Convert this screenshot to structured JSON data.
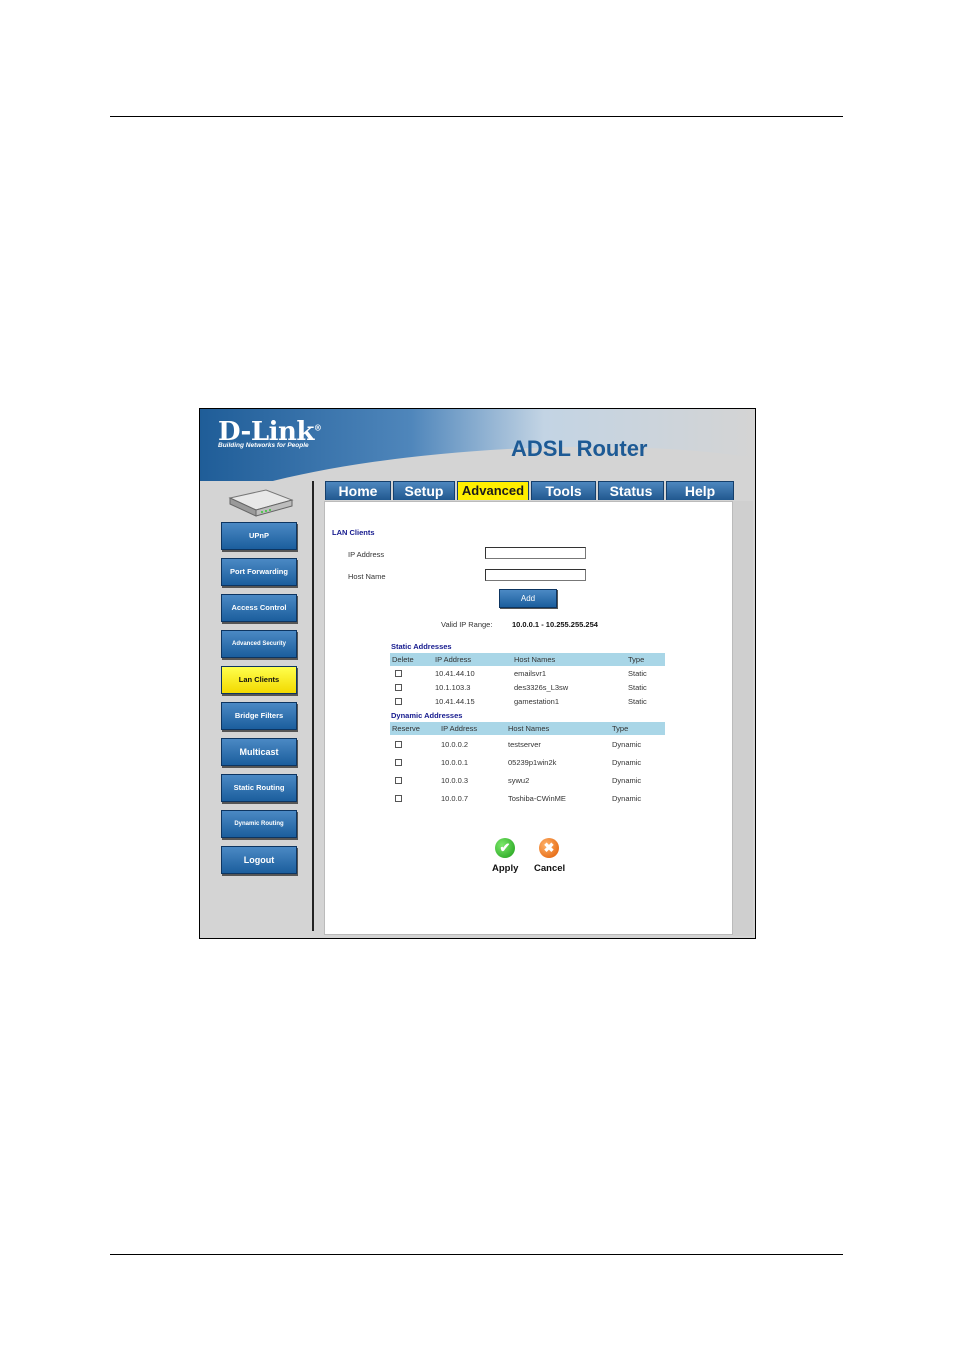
{
  "brand": {
    "logo_text": "D-Link",
    "logo_mark": "®",
    "tagline": "Building Networks for People",
    "product_title": "ADSL Router"
  },
  "tabs": [
    {
      "label": "Home"
    },
    {
      "label": "Setup"
    },
    {
      "label": "Advanced",
      "active": true
    },
    {
      "label": "Tools"
    },
    {
      "label": "Status"
    },
    {
      "label": "Help"
    }
  ],
  "sidebar": {
    "icon": "router-device-icon",
    "items": [
      {
        "label": "UPnP"
      },
      {
        "label": "Port Forwarding"
      },
      {
        "label": "Access Control"
      },
      {
        "label": "Advanced Security"
      },
      {
        "label": "Lan Clients",
        "active": true
      },
      {
        "label": "Bridge Filters"
      },
      {
        "label": "Multicast"
      },
      {
        "label": "Static Routing"
      },
      {
        "label": "Dynamic Routing"
      },
      {
        "label": "Logout"
      }
    ]
  },
  "lan_clients": {
    "title": "LAN Clients",
    "ip_address_label": "IP Address",
    "ip_address_value": "",
    "host_name_label": "Host Name",
    "host_name_value": "",
    "add_label": "Add",
    "valid_range_label": "Valid IP Range:",
    "valid_range_value": "10.0.0.1 - 10.255.255.254"
  },
  "static_addresses": {
    "title": "Static Addresses",
    "columns": [
      "Delete",
      "IP Address",
      "Host Names",
      "Type"
    ],
    "rows": [
      {
        "ip": "10.41.44.10",
        "host": "emailsvr1",
        "type": "Static"
      },
      {
        "ip": "10.1.103.3",
        "host": "des3326s_L3sw",
        "type": "Static"
      },
      {
        "ip": "10.41.44.15",
        "host": "gamestation1",
        "type": "Static"
      }
    ]
  },
  "dynamic_addresses": {
    "title": "Dynamic Addresses",
    "columns": [
      "Reserve",
      "IP Address",
      "Host Names",
      "Type"
    ],
    "rows": [
      {
        "ip": "10.0.0.2",
        "host": "testserver",
        "type": "Dynamic"
      },
      {
        "ip": "10.0.0.1",
        "host": "05239p1win2k",
        "type": "Dynamic"
      },
      {
        "ip": "10.0.0.3",
        "host": "sywu2",
        "type": "Dynamic"
      },
      {
        "ip": "10.0.0.7",
        "host": "Toshiba-CWinME",
        "type": "Dynamic"
      }
    ]
  },
  "actions": {
    "apply_label": "Apply",
    "apply_icon": "check-icon",
    "cancel_label": "Cancel",
    "cancel_icon": "x-icon"
  },
  "colors": {
    "brand_blue": "#1d5a95",
    "active_tab": "#ffef00",
    "table_header": "#a9d6e7",
    "section_title": "#151a8e"
  }
}
